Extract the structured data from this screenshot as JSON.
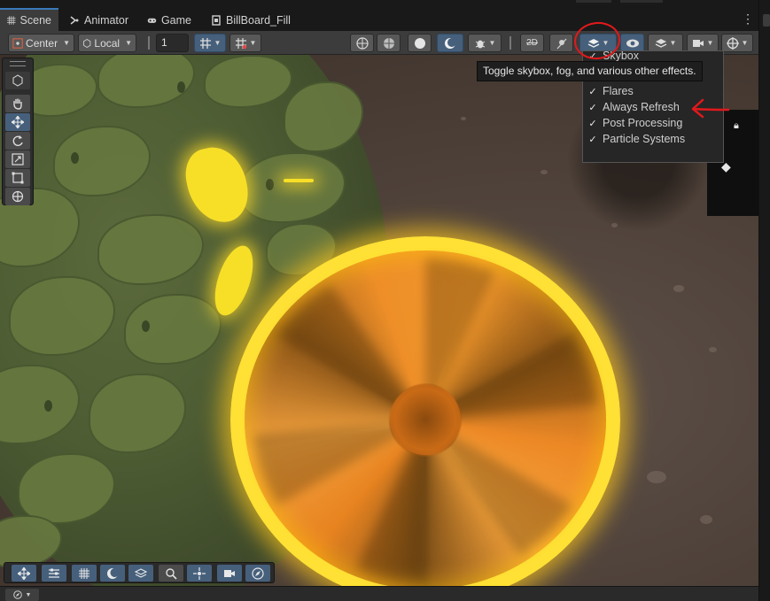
{
  "tabs": [
    {
      "label": "Scene",
      "icon": "grid-icon",
      "active": true
    },
    {
      "label": "Animator",
      "icon": "animator-icon",
      "active": false
    },
    {
      "label": "Game",
      "icon": "gamepad-icon",
      "active": false
    },
    {
      "label": "BillBoard_Fill",
      "icon": "shader-icon",
      "active": false
    }
  ],
  "tab_menu_glyph": "⋮",
  "toolbar": {
    "pivot_label": "Center",
    "space_label": "Local",
    "grid_snap_value": "1"
  },
  "tooltip": "Toggle skybox, fog, and various other effects.",
  "effects_menu": {
    "partial_item": "Skybox",
    "items": [
      {
        "label": "Flares",
        "checked": true
      },
      {
        "label": "Always Refresh",
        "checked": true
      },
      {
        "label": "Post Processing",
        "checked": true
      },
      {
        "label": "Particle Systems",
        "checked": true
      }
    ],
    "check_glyph": "✓"
  },
  "annotations": {
    "color": "#e0191b"
  },
  "colors": {
    "accent": "#46607c",
    "tab_highlight": "#3a79bb",
    "portal_ring": "#ffe034",
    "portal_fill": "#f29629"
  }
}
